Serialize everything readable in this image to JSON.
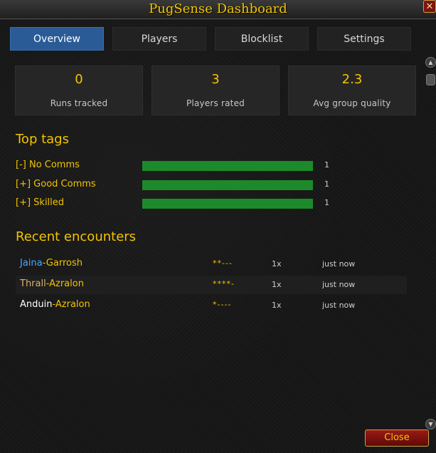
{
  "window": {
    "title": "PugSense Dashboard",
    "close_glyph": "✕"
  },
  "tabs": [
    {
      "label": "Overview",
      "active": true
    },
    {
      "label": "Players",
      "active": false
    },
    {
      "label": "Blocklist",
      "active": false
    },
    {
      "label": "Settings",
      "active": false
    }
  ],
  "stats": [
    {
      "value": "0",
      "label": "Runs tracked"
    },
    {
      "value": "3",
      "label": "Players rated"
    },
    {
      "value": "2.3",
      "label": "Avg group quality"
    }
  ],
  "top_tags": {
    "heading": "Top tags",
    "items": [
      {
        "label": "[-] No Comms",
        "count": "1",
        "fill": 1.0
      },
      {
        "label": "[+] Good Comms",
        "count": "1",
        "fill": 1.0
      },
      {
        "label": "[+] Skilled",
        "count": "1",
        "fill": 1.0
      }
    ]
  },
  "recent": {
    "heading": "Recent encounters",
    "rows": [
      {
        "player": "Jaina",
        "realm": "-Garrosh",
        "player_color": "#4aa8ff",
        "rating": "**---",
        "count": "1x",
        "time": "just now"
      },
      {
        "player": "Thrall",
        "realm": "-Azralon",
        "player_color": "#d9b36a",
        "rating": "****-",
        "count": "1x",
        "time": "just now"
      },
      {
        "player": "Anduin",
        "realm": "-Azralon",
        "player_color": "#ffffff",
        "rating": "*----",
        "count": "1x",
        "time": "just now"
      }
    ]
  },
  "footer": {
    "close_label": "Close"
  },
  "scroll": {
    "up_icon": "chevron-up-icon",
    "down_icon": "chevron-down-icon"
  },
  "colors": {
    "accent": "#f2c400",
    "tab_active": "#2a5b96",
    "bar": "#1c8a2a",
    "realm": "#f2c400"
  }
}
